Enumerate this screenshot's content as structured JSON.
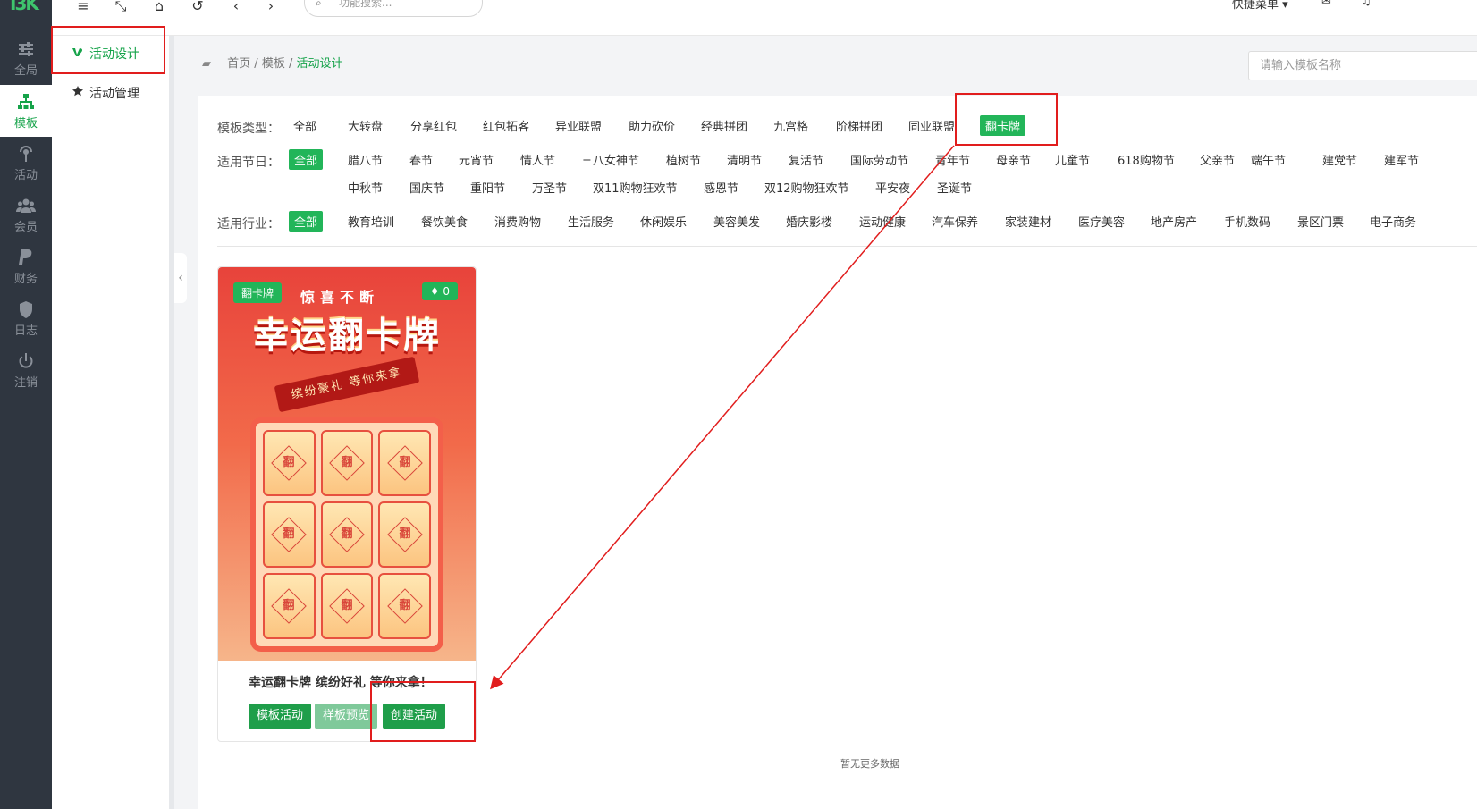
{
  "rail": {
    "logo": "I3K",
    "items": [
      {
        "label": "全局",
        "icon": "sliders-icon"
      },
      {
        "label": "模板",
        "icon": "sitemap-icon",
        "active": true
      },
      {
        "label": "活动",
        "icon": "broadcast-icon"
      },
      {
        "label": "会员",
        "icon": "users-icon"
      },
      {
        "label": "财务",
        "icon": "paypal-icon"
      },
      {
        "label": "日志",
        "icon": "shield-icon"
      },
      {
        "label": "注销",
        "icon": "power-icon"
      }
    ]
  },
  "subnav": {
    "items": [
      {
        "label": "活动设计",
        "icon": "vine-icon",
        "active": true
      },
      {
        "label": "活动管理",
        "icon": "star-icon"
      }
    ]
  },
  "topbar": {
    "search_placeholder": "功能搜索...",
    "quick_menu": "快捷菜单"
  },
  "breadcrumb": {
    "home": "首页",
    "templates": "模板",
    "current": "活动设计"
  },
  "template_search_placeholder": "请输入模板名称",
  "filters": {
    "type": {
      "label": "模板类型：",
      "items": [
        "全部",
        "大转盘",
        "分享红包",
        "红包拓客",
        "异业联盟",
        "助力砍价",
        "经典拼团",
        "九宫格",
        "阶梯拼团",
        "同业联盟",
        "翻卡牌"
      ],
      "selected": "翻卡牌"
    },
    "holiday": {
      "label": "适用节日：",
      "items": [
        "全部",
        "腊八节",
        "春节",
        "元宵节",
        "情人节",
        "三八女神节",
        "植树节",
        "清明节",
        "复活节",
        "国际劳动节",
        "青年节",
        "母亲节",
        "儿童节",
        "618购物节",
        "父亲节",
        "端午节",
        "建党节",
        "建军节"
      ],
      "items_row2": [
        "中秋节",
        "国庆节",
        "重阳节",
        "万圣节",
        "双11购物狂欢节",
        "感恩节",
        "双12购物狂欢节",
        "平安夜",
        "圣诞节"
      ],
      "selected": "全部"
    },
    "industry": {
      "label": "适用行业：",
      "items": [
        "全部",
        "教育培训",
        "餐饮美食",
        "消费购物",
        "生活服务",
        "休闲娱乐",
        "美容美发",
        "婚庆影楼",
        "运动健康",
        "汽车保养",
        "家装建材",
        "医疗美容",
        "地产房产",
        "手机数码",
        "景区门票",
        "电子商务"
      ],
      "selected": "全部"
    }
  },
  "card": {
    "badge": "翻卡牌",
    "likes": "0",
    "poster_subtitle": "惊喜不断",
    "poster_title": "幸运翻卡牌",
    "poster_ribbon": "缤纷豪礼 等你来拿",
    "flip_char": "翻",
    "title": "幸运翻卡牌 缤纷好礼 等你来拿！",
    "buttons": {
      "template": "模板活动",
      "preview": "样板预览",
      "create": "创建活动"
    }
  },
  "empty_text": "暂无更多数据",
  "colors": {
    "accent": "#22b559",
    "rail_bg": "#2f3640",
    "annotation": "#e11d1d"
  }
}
